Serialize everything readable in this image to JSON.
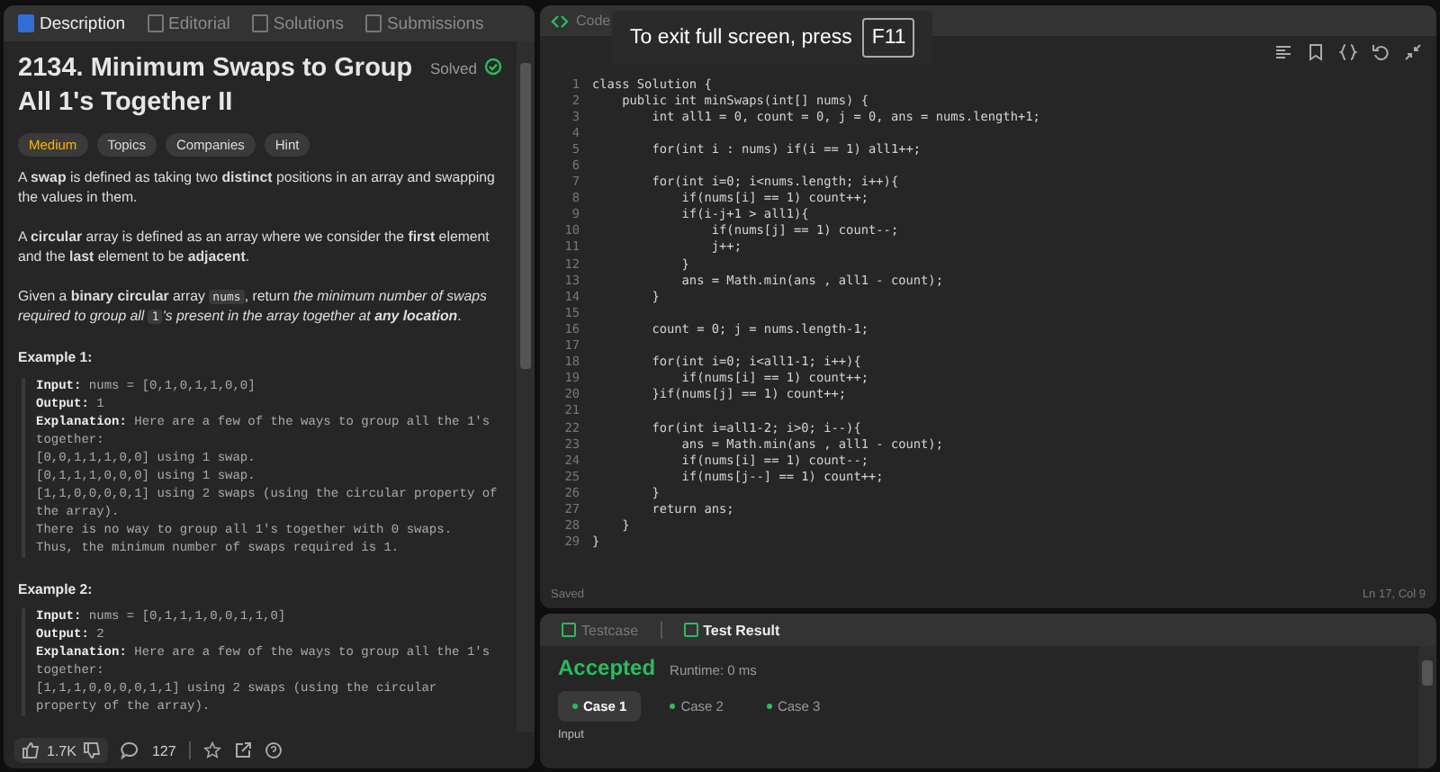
{
  "left_tabs": [
    {
      "label": "Description",
      "selected": true
    },
    {
      "label": "Editorial",
      "selected": false
    },
    {
      "label": "Solutions",
      "selected": false
    },
    {
      "label": "Submissions",
      "selected": false
    }
  ],
  "problem": {
    "title": "2134. Minimum Swaps to Group All 1's Together II",
    "status": "Solved",
    "difficulty": "Medium",
    "tags": [
      "Topics",
      "Companies",
      "Hint"
    ],
    "paragraphs": [
      [
        {
          "kind": "text",
          "text": "A **swap** is defined as taking two **distinct** positions in an array and swapping the values in them."
        }
      ],
      [
        {
          "kind": "text",
          "text": "A **circular** array is defined as an array where we consider the **first** element and the **last** element to be **adjacent**."
        }
      ],
      [
        {
          "kind": "text",
          "text": "Given a **binary circular** array "
        },
        {
          "kind": "code",
          "text": "nums"
        },
        {
          "kind": "text",
          "text": ", return "
        },
        {
          "kind": "italic",
          "text": "the minimum number of swaps required to group all "
        },
        {
          "kind": "code",
          "text": "1"
        },
        {
          "kind": "italic",
          "text": "'s present in the array together at **any location**"
        },
        {
          "kind": "text",
          "text": "."
        }
      ]
    ],
    "examples": [
      {
        "title": "Example 1:",
        "lines": [
          "**Input:** nums = [0,1,0,1,1,0,0]",
          "**Output:** 1",
          "**Explanation:** Here are a few of the ways to group all the 1's together:",
          "[0,0,1,1,1,0,0] using 1 swap.",
          "[0,1,1,1,0,0,0] using 1 swap.",
          "[1,1,0,0,0,0,1] using 2 swaps (using the circular property of the array).",
          "There is no way to group all 1's together with 0 swaps.",
          "Thus, the minimum number of swaps required is 1."
        ]
      },
      {
        "title": "Example 2:",
        "lines": [
          "**Input:** nums = [0,1,1,1,0,0,1,1,0]",
          "**Output:** 2",
          "**Explanation:** Here are a few of the ways to group all the 1's together:",
          "[1,1,1,0,0,0,0,1,1] using 2 swaps (using the circular property of the array)."
        ]
      }
    ],
    "likes": "1.7K",
    "comments": "127"
  },
  "editor": {
    "title": "Code",
    "overlay": {
      "message": "To exit full screen, press",
      "key": "F11"
    },
    "lines": [
      {
        "number": "1",
        "code": "class Solution {"
      },
      {
        "number": "2",
        "code": "    public int minSwaps(int[] nums) {"
      },
      {
        "number": "3",
        "code": "        int all1 = 0, count = 0, j = 0, ans = nums.length+1;"
      },
      {
        "number": "4"
      },
      {
        "number": "5",
        "code": "        for(int i : nums) if(i == 1) all1++;"
      },
      {
        "number": "6"
      },
      {
        "number": "7",
        "code": "        for(int i=0; i<nums.length; i++){"
      },
      {
        "number": "8",
        "code": "            if(nums[i] == 1) count++;"
      },
      {
        "number": "9",
        "code": "            if(i-j+1 > all1){"
      },
      {
        "number": "10",
        "code": "                if(nums[j] == 1) count--;"
      },
      {
        "number": "11",
        "code": "                j++;"
      },
      {
        "number": "12",
        "code": "            }"
      },
      {
        "number": "13",
        "code": "            ans = Math.min(ans , all1 - count);"
      },
      {
        "number": "14",
        "code": "        }"
      },
      {
        "number": "15"
      },
      {
        "number": "16",
        "code": "        count = 0; j = nums.length-1;"
      },
      {
        "number": "17"
      },
      {
        "number": "18",
        "code": "        for(int i=0; i<all1-1; i++){"
      },
      {
        "number": "19",
        "code": "            if(nums[i] == 1) count++;"
      },
      {
        "number": "20",
        "code": "        }if(nums[j] == 1) count++;"
      },
      {
        "number": "21"
      },
      {
        "number": "22",
        "code": "        for(int i=all1-2; i>0; i--){"
      },
      {
        "number": "23",
        "code": "            ans = Math.min(ans , all1 - count);"
      },
      {
        "number": "24",
        "code": "            if(nums[i] == 1) count--;"
      },
      {
        "number": "25",
        "code": "            if(nums[j--] == 1) count++;"
      },
      {
        "number": "26",
        "code": "        }"
      },
      {
        "number": "27",
        "code": "        return ans;"
      },
      {
        "number": "28",
        "code": "    }"
      },
      {
        "number": "29",
        "code": "}"
      }
    ],
    "status": "Saved",
    "cursor": "Ln 17, Col 9"
  },
  "result_tabs": [
    {
      "label": "Testcase",
      "selected": false
    },
    {
      "label": "Test Result",
      "selected": true
    }
  ],
  "result": {
    "verdict": "Accepted",
    "runtime": "Runtime: 0 ms",
    "cases": [
      {
        "label": "Case 1",
        "selected": true
      },
      {
        "label": "Case 2",
        "selected": false
      },
      {
        "label": "Case 3",
        "selected": false
      }
    ],
    "section": "Input"
  }
}
